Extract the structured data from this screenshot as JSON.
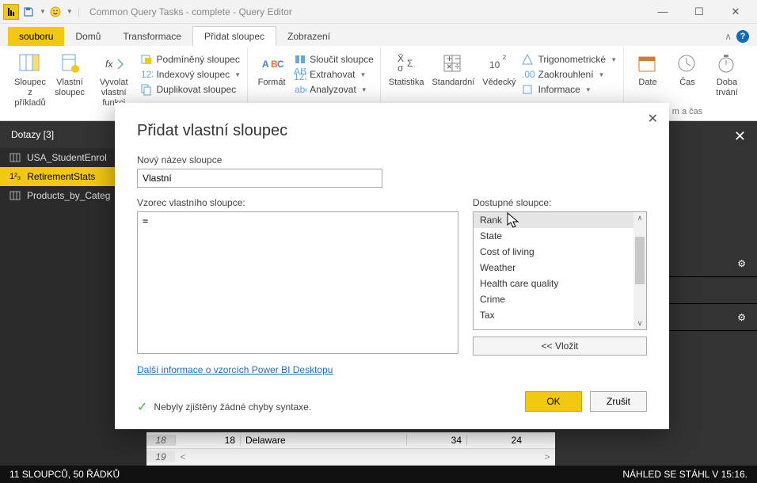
{
  "titlebar": {
    "title": "Common Query Tasks - complete - Query Editor"
  },
  "tabs": {
    "file": "souboru",
    "home": "Domů",
    "transform": "Transformace",
    "addcol": "Přidat sloupec",
    "view": "Zobrazení"
  },
  "ribbon": {
    "g1": {
      "b1": "Sloupec z\npříkladů",
      "b2": "Vlastní\nsloupec",
      "b3": "Vyvolat\nvlastní funkci",
      "s1": "Podmíněný sloupec",
      "s2": "Indexový sloupec",
      "s3": "Duplikovat sloupec"
    },
    "g2": {
      "b1": "Formát",
      "s1": "Sloučit sloupce",
      "s2": "Extrahovat",
      "s3": "Analyzovat"
    },
    "g3": {
      "b1": "Statistika",
      "b2": "Standardní",
      "b3": "Vědecký",
      "s1": "Trigonometrické",
      "s2": "Zaokrouhlení",
      "s3": "Informace"
    },
    "g4": {
      "b1": "Date",
      "b2": "Čas",
      "b3": "Doba\ntrvání",
      "label": "m a čas"
    }
  },
  "queries": {
    "header": "Dotazy [3]",
    "items": [
      "USA_StudentEnrol",
      "RetirementStats",
      "Products_by_Categ"
    ]
  },
  "grid": {
    "rows": [
      {
        "n": "18",
        "a": "18",
        "b": "Delaware",
        "c": "34",
        "d": "24"
      },
      {
        "n": "19",
        "a": "",
        "b": "",
        "c": "",
        "d": ""
      }
    ]
  },
  "dialog": {
    "title": "Přidat vlastní sloupec",
    "new_name_label": "Nový název sloupce",
    "new_name_value": "Vlastní",
    "formula_label": "Vzorec vlastního sloupce:",
    "formula_value": "=",
    "avail_label": "Dostupné sloupce:",
    "columns": [
      "Rank",
      "State",
      "Cost of living",
      "Weather",
      "Health care quality",
      "Crime",
      "Tax"
    ],
    "insert_btn": "<< Vložit",
    "link": "Další informace o vzorcích Power BI Desktopu",
    "validation": "Nebyly zjištěny žádné chyby syntaxe.",
    "ok": "OK",
    "cancel": "Zrušit"
  },
  "status": {
    "left": "11 SLOUPCŮ, 50 ŘÁDKŮ",
    "right": "NÁHLED SE STÁHL V 15:16."
  }
}
